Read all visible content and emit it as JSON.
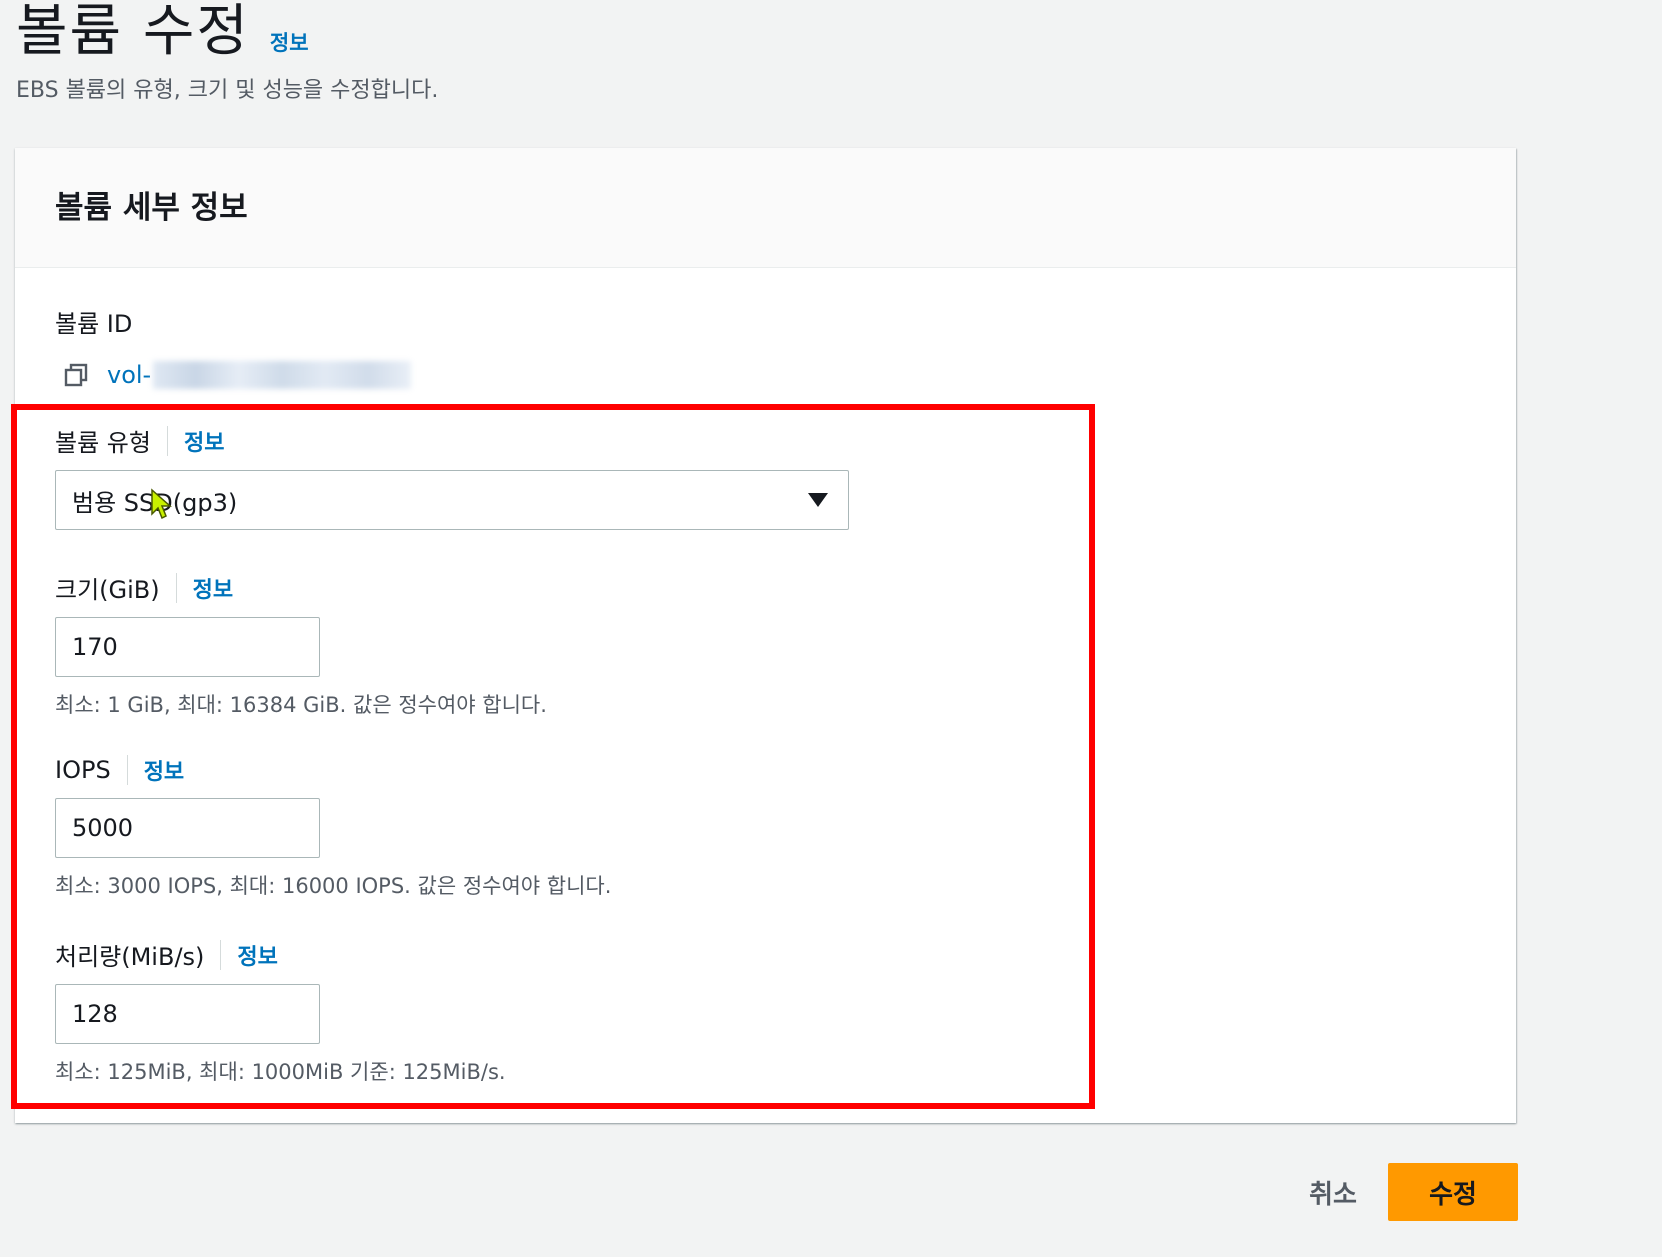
{
  "header": {
    "title": "볼륨 수정",
    "info_link": "정보",
    "description": "EBS 볼륨의 유형, 크기 및 성능을 수정합니다."
  },
  "panel": {
    "title": "볼륨 세부 정보",
    "volume_id": {
      "label": "볼륨 ID",
      "value": "vol-",
      "icon": "copy-icon"
    },
    "volume_type": {
      "label": "볼륨 유형",
      "info": "정보",
      "selected": "범용 SSD(gp3)"
    },
    "size": {
      "label": "크기(GiB)",
      "info": "정보",
      "value": "170",
      "hint": "최소: 1 GiB, 최대: 16384 GiB. 값은 정수여야 합니다."
    },
    "iops": {
      "label": "IOPS",
      "info": "정보",
      "value": "5000",
      "hint": "최소: 3000 IOPS, 최대: 16000 IOPS. 값은 정수여야 합니다."
    },
    "throughput": {
      "label": "처리량(MiB/s)",
      "info": "정보",
      "value": "128",
      "hint": "최소: 125MiB, 최대: 1000MiB 기준: 125MiB/s."
    }
  },
  "actions": {
    "cancel": "취소",
    "submit": "수정"
  },
  "colors": {
    "link": "#0073bb",
    "primary_button": "#ff9900",
    "highlight_box": "#ff0000",
    "background": "#f2f3f3"
  }
}
